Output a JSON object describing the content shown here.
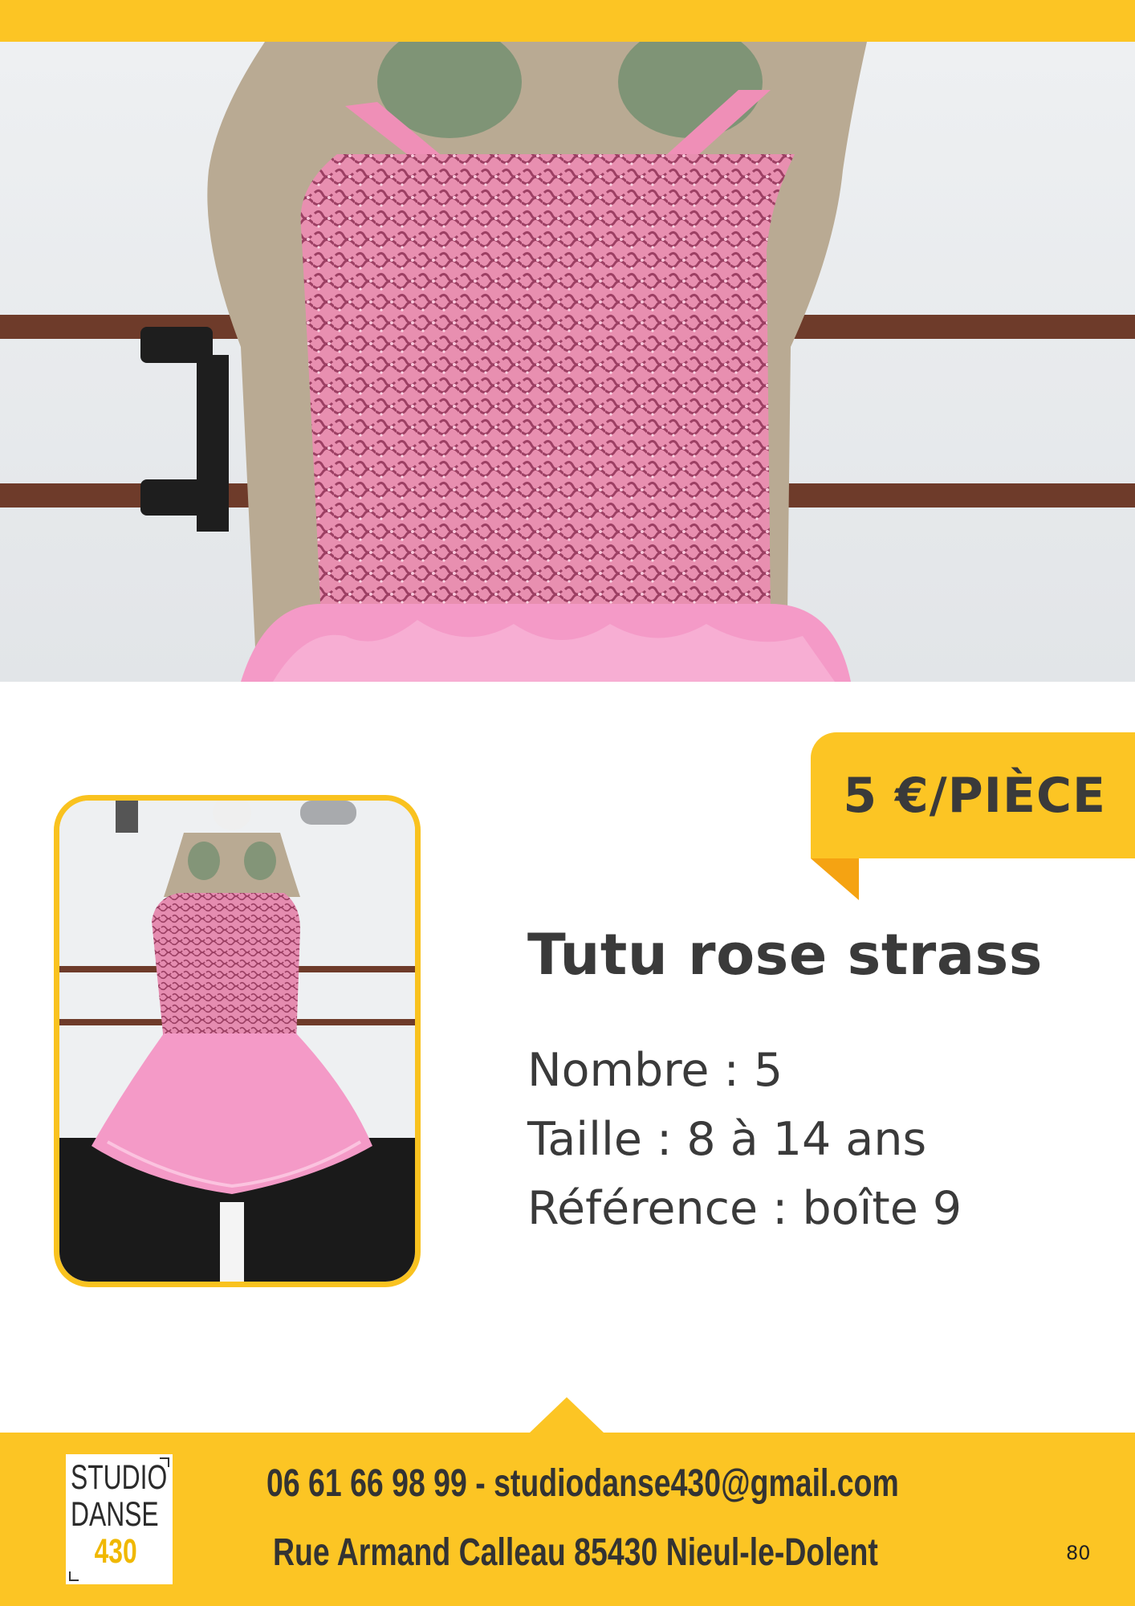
{
  "product": {
    "price": "5 €/PIÈCE",
    "title": "Tutu rose strass",
    "details": [
      "Nombre : 5",
      "Taille : 8 à 14 ans",
      "Référence : boîte 9"
    ]
  },
  "footer": {
    "logo_lines": [
      "STUDIO",
      "DANSE",
      "430"
    ],
    "contact_line": "06 61 66 98 99 - studiodanse430@gmail.com",
    "address_line": "Rue Armand Calleau 85430 Nieul-le-Dolent",
    "page_number": "80"
  },
  "colors": {
    "accent": "#fcc524",
    "accent_dark": "#f5a312",
    "text": "#3a3a3a",
    "dress_pink": "#f29ac4"
  }
}
